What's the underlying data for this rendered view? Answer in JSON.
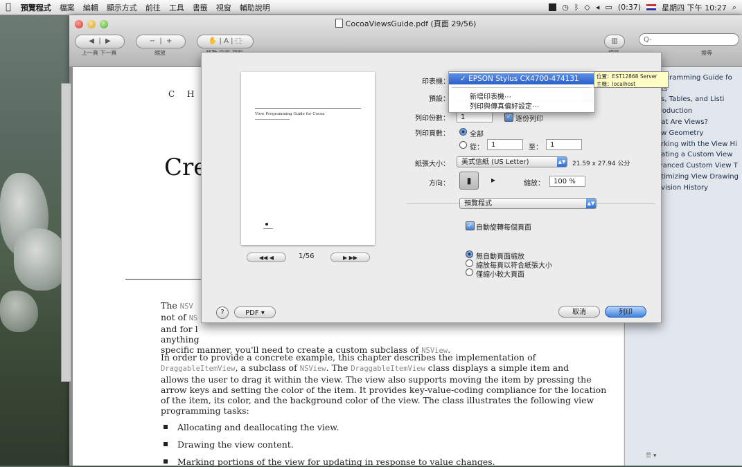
{
  "menubar": {
    "app": "預覽程式",
    "items": [
      "檔案",
      "編輯",
      "顯示方式",
      "前往",
      "工具",
      "書籤",
      "視窗",
      "輔助說明"
    ],
    "battery": "(0:37)",
    "clock": "星期四 下午 10:27"
  },
  "window": {
    "title": "CocoaViewsGuide.pdf (頁面 29/56)",
    "toolbar": {
      "prev_next_label": "上一頁 下一頁",
      "zoom_label": "縮放",
      "move_label": "移動 文字 選取",
      "sidebar_label": "標籤",
      "search_placeholder": "Q-",
      "search_label": "搜尋"
    }
  },
  "document": {
    "chapter": "C H A",
    "title": "Cre",
    "para1_lines": [
      {
        "a": "The ",
        "code": "NSV",
        "b": ""
      },
      {
        "a": "not of ",
        "code": "NS",
        "b": ""
      },
      {
        "a": "and for l",
        "code": "",
        "b": ""
      },
      {
        "a": "anything",
        "code": "",
        "b": ""
      }
    ],
    "para1_end": {
      "a": "specific manner, you'll need to create a custom subclass of ",
      "code": "NSView",
      "b": "."
    },
    "para2": {
      "line1": "In order to provide a concrete example, this chapter describes the implementation of",
      "line2_code1": "DraggableItemView",
      "line2_mid": ", a subclass of ",
      "line2_code2": "NSView",
      "line2_mid2": ". The ",
      "line2_code3": "DraggableItemView",
      "line2_end": " class displays a simple item and",
      "line3": "allows the user to drag it within the view. The view also supports moving the item by pressing the",
      "line4": "arrow keys and setting the color of the item. It provides key-value-coding compliance for the location",
      "line5": "of the item, its color, and the background color of the view. The class illustrates the following view",
      "line6": "programming tasks:"
    },
    "bullets": [
      "Allocating and deallocating the view.",
      "Drawing the view content.",
      "Marking portions of the view for updating in response to value changes."
    ]
  },
  "sidebar": {
    "toc": [
      "Programming Guide fo",
      "nts",
      "es, Tables, and Listi",
      "troduction",
      "hat Are Views?",
      "ew Geometry",
      "orking with the View Hi",
      "eating a Custom View",
      "lvanced Custom View T",
      "ptimizing View Drawing",
      "evision History"
    ],
    "footer": "☰ ▾"
  },
  "print": {
    "preview_title": "View Programming Guide for Cocoa",
    "page_counter": "1/56",
    "nav_prev": "◀◀ ◀",
    "nav_next": "▶ ▶▶",
    "printer_label": "印表機：",
    "presets_label": "預設：",
    "copies_label": "列印份數：",
    "copies_value": "1",
    "collate_label": "逐份列印",
    "pages_label": "列印頁數：",
    "pages_all": "全部",
    "pages_from": "從：",
    "pages_from_value": "1",
    "pages_to": "至：",
    "pages_to_value": "1",
    "paper_label": "紙張大小：",
    "paper_value": "美式信紙 (US Letter)",
    "paper_dims": "21.59 x 27.94 公分",
    "orientation_label": "方向：",
    "scale_label": "縮放：",
    "scale_value": "100 %",
    "app_section": "預覽程式",
    "auto_rotate": "自動旋轉每個頁面",
    "scale_opt1": "無自動頁面縮放",
    "scale_opt2": "縮放每頁以符合紙張大小",
    "scale_opt3": "僅縮小較大頁面",
    "help": "?",
    "pdf": "PDF ▾",
    "cancel": "取消",
    "print": "列印"
  },
  "printer_menu": {
    "selected": "✓ EPSON Stylus CX4700-474131",
    "add_printer": "新增印表機⋯",
    "prefs": "列印與傳真偏好設定⋯"
  },
  "tooltip": {
    "line1": "位置：EST12868 Server",
    "line2": "主機：localhost"
  }
}
